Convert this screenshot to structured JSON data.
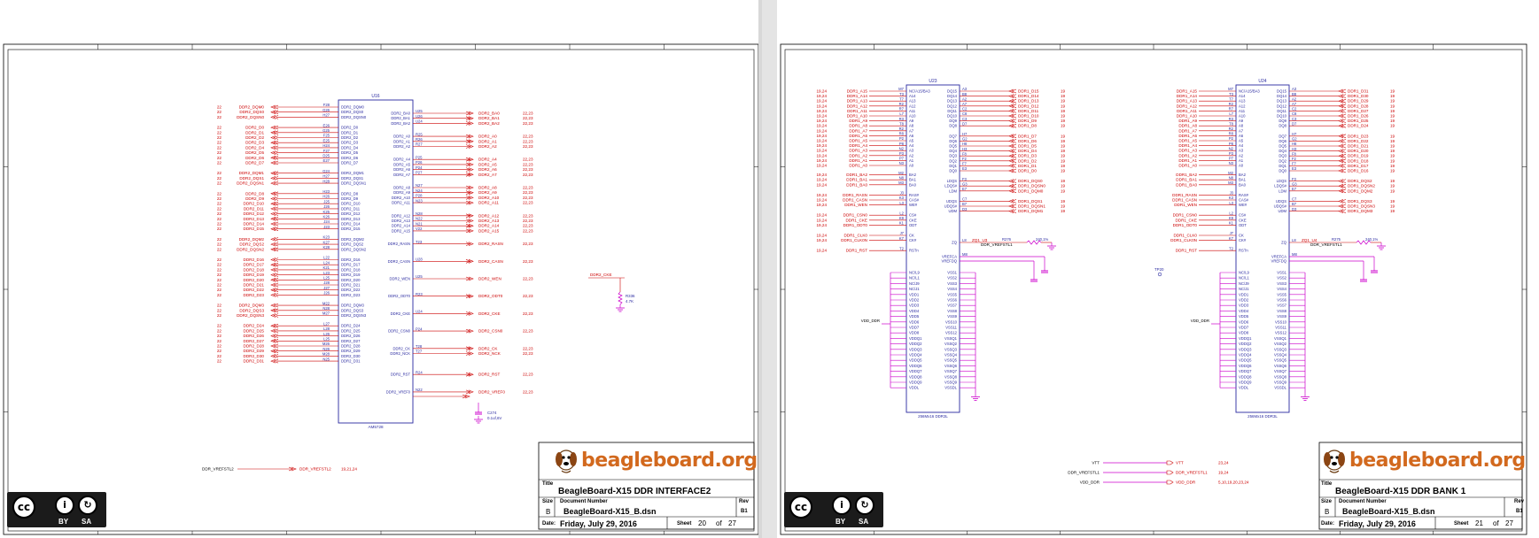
{
  "colors": {
    "wire": "#cc0000",
    "component": "#2a2aa0",
    "pin": "#cc00cc",
    "frame": "#000000",
    "brand": "#d2691e"
  },
  "left_sheet": {
    "title_block": {
      "logo_text": "beagleboard.org",
      "title_label": "Title",
      "title": "BeagleBoard-X15 DDR INTERFACE2",
      "size_label": "Size",
      "size": "B",
      "doc_label": "Document Number",
      "doc_number": "BeagleBoard-X15_B.dsn",
      "rev_label": "Rev",
      "rev": "B1",
      "date_label": "Date:",
      "date": "Friday, July 29, 2016",
      "sheet_label": "Sheet",
      "sheet": "20",
      "of_label": "of",
      "total": "27"
    },
    "license": {
      "by": "BY",
      "sa": "SA",
      "cc": "cc",
      "by_glyph": "i",
      "sa_glyph": "↻"
    },
    "refdes": "U16",
    "part": "AM5728",
    "vref_net": "DDR_VREFSTL2",
    "vref_dest": "DDR_VREFSTL2",
    "vref_page": "19,21,24",
    "left_pins": [
      {
        "pin": "F28",
        "name": "DDR2_DQM0"
      },
      {
        "pin": "G26",
        "name": "DDR2_DQS0"
      },
      {
        "pin": "H27",
        "name": "DDR2_DQSN0"
      },
      {
        "pin": "E26",
        "name": "DDR2_D0"
      },
      {
        "pin": "G25",
        "name": "DDR2_D1"
      },
      {
        "pin": "F25",
        "name": "DDR2_D2"
      },
      {
        "pin": "E25",
        "name": "DDR2_D3"
      },
      {
        "pin": "H24",
        "name": "DDR2_D4"
      },
      {
        "pin": "F27",
        "name": "DDR2_D5"
      },
      {
        "pin": "D25",
        "name": "DDR2_D6"
      },
      {
        "pin": "E27",
        "name": "DDR2_D7"
      },
      {
        "pin": "G24",
        "name": "DDR2_DQM1"
      },
      {
        "pin": "H27",
        "name": "DDR2_DQS1"
      },
      {
        "pin": "H28",
        "name": "DDR2_DQSN1"
      },
      {
        "pin": "H23",
        "name": "DDR2_D8"
      },
      {
        "pin": "H26",
        "name": "DDR2_D9"
      },
      {
        "pin": "J25",
        "name": "DDR2_D10"
      },
      {
        "pin": "J26",
        "name": "DDR2_D11"
      },
      {
        "pin": "K25",
        "name": "DDR2_D12"
      },
      {
        "pin": "K26",
        "name": "DDR2_D13"
      },
      {
        "pin": "J24",
        "name": "DDR2_D14"
      },
      {
        "pin": "J23",
        "name": "DDR2_D15"
      },
      {
        "pin": "K23",
        "name": "DDR2_DQM2"
      },
      {
        "pin": "K27",
        "name": "DDR2_DQS2"
      },
      {
        "pin": "K28",
        "name": "DDR2_DQSN2"
      },
      {
        "pin": "L22",
        "name": "DDR2_D16"
      },
      {
        "pin": "L24",
        "name": "DDR2_D17"
      },
      {
        "pin": "K21",
        "name": "DDR2_D18"
      },
      {
        "pin": "L23",
        "name": "DDR2_D19"
      },
      {
        "pin": "L25",
        "name": "DDR2_D20"
      },
      {
        "pin": "J28",
        "name": "DDR2_D21"
      },
      {
        "pin": "J27",
        "name": "DDR2_D22"
      },
      {
        "pin": "J26",
        "name": "DDR2_D23"
      },
      {
        "pin": "M22",
        "name": "DDR2_DQM3"
      },
      {
        "pin": "N28",
        "name": "DDR2_DQS3"
      },
      {
        "pin": "M27",
        "name": "DDR2_DQSN3"
      },
      {
        "pin": "L27",
        "name": "DDR2_D24"
      },
      {
        "pin": "L28",
        "name": "DDR2_D25"
      },
      {
        "pin": "L26",
        "name": "DDR2_D26"
      },
      {
        "pin": "L25",
        "name": "DDR2_D27"
      },
      {
        "pin": "M26",
        "name": "DDR2_D28"
      },
      {
        "pin": "N26",
        "name": "DDR2_D29"
      },
      {
        "pin": "M28",
        "name": "DDR2_D30"
      },
      {
        "pin": "N25",
        "name": "DDR2_D31"
      }
    ],
    "right_pins": [
      {
        "pin": "U25",
        "name": "DDR2_BA0"
      },
      {
        "pin": "U26",
        "name": "DDR2_BA1"
      },
      {
        "pin": "U24",
        "name": "DDR2_BA2"
      },
      {
        "pin": "R25",
        "name": "DDR2_A0"
      },
      {
        "pin": "R26",
        "name": "DDR2_A1"
      },
      {
        "pin": "R27",
        "name": "DDR2_A2"
      },
      {
        "pin": "P25",
        "name": "DDR2_A4"
      },
      {
        "pin": "P26",
        "name": "DDR2_A5"
      },
      {
        "pin": "P24",
        "name": "DDR2_A6"
      },
      {
        "pin": "P27",
        "name": "DDR2_A7"
      },
      {
        "pin": "N27",
        "name": "DDR2_A8"
      },
      {
        "pin": "N24",
        "name": "DDR2_A9"
      },
      {
        "pin": "P28",
        "name": "DDR2_A10"
      },
      {
        "pin": "N23",
        "name": "DDR2_A11"
      },
      {
        "pin": "N28",
        "name": "DDR2_A12"
      },
      {
        "pin": "N22",
        "name": "DDR2_A13"
      },
      {
        "pin": "N21",
        "name": "DDR2_A14"
      },
      {
        "pin": "V22",
        "name": "DDR2_A15"
      },
      {
        "pin": "T23",
        "name": "DDR2_RASN"
      },
      {
        "pin": "U28",
        "name": "DDR2_CASN"
      },
      {
        "pin": "U25",
        "name": "DDR2_WEN"
      },
      {
        "pin": "R23",
        "name": "DDR2_ODT0"
      },
      {
        "pin": "U24",
        "name": "DDR2_CKE"
      },
      {
        "pin": "P24",
        "name": "DDR2_CSN0"
      },
      {
        "pin": "T28",
        "name": "DDR2_CK"
      },
      {
        "pin": "T27",
        "name": "DDR2_NCK"
      },
      {
        "pin": "R24",
        "name": "DDR2_RST"
      },
      {
        "pin": "N22",
        "name": "DDR2_VREF0"
      }
    ],
    "cap": {
      "ref": "C274",
      "val": "0.1uf,6V"
    },
    "res": {
      "ref": "R336",
      "val": "4.7K",
      "net": "DDR2_CKE"
    }
  },
  "right_sheet": {
    "title_block": {
      "logo_text": "beagleboard.org",
      "title_label": "Title",
      "title": "BeagleBoard-X15 DDR BANK 1",
      "size_label": "Size",
      "size": "B",
      "doc_label": "Document Number",
      "doc_number": "BeagleBoard-X15_B.dsn",
      "rev_label": "Rev",
      "rev": "B1",
      "date_label": "Date:",
      "date": "Friday, July 29, 2016",
      "sheet_label": "Sheet",
      "sheet": "21",
      "of_label": "of",
      "total": "27"
    },
    "license": {
      "by": "BY",
      "sa": "SA",
      "cc": "cc",
      "by_glyph": "i",
      "sa_glyph": "↻"
    },
    "chip1": {
      "refdes": "U23",
      "part": "256Mx16 DDR3L",
      "zq_net": "ZQ1_U3",
      "zq_res": "R276",
      "zq_val": "240,1%",
      "vref": "DDR_VREFSTL1",
      "vdd": "VDD_DDR"
    },
    "chip2": {
      "refdes": "U24",
      "part": "256Mx16 DDR3L",
      "zq_net": "ZQ1_U4",
      "zq_res": "R275",
      "zq_val": "240,1%",
      "vref": "DDR_VREFSTL1",
      "vdd": "VDD_DDR"
    },
    "power_nets": [
      {
        "net": "VTT",
        "dest": "VTT",
        "page": "23,24"
      },
      {
        "net": "DDR_VREFSTL1",
        "dest": "DDR_VREFSTL1",
        "page": "19,24"
      },
      {
        "net": "VDD_DDR",
        "dest": "VDD_DDR",
        "page": "5,10,19,20,23,24"
      }
    ],
    "chip_left_pins": [
      {
        "pin": "M7",
        "name": "NC/A15/BA3"
      },
      {
        "pin": "T3",
        "name": "A14"
      },
      {
        "pin": "T7",
        "name": "A13"
      },
      {
        "pin": "R2",
        "name": "A12"
      },
      {
        "pin": "R7",
        "name": "A11"
      },
      {
        "pin": "L7",
        "name": "A10"
      },
      {
        "pin": "R3",
        "name": "A9"
      },
      {
        "pin": "T8",
        "name": "A8"
      },
      {
        "pin": "R2",
        "name": "A7"
      },
      {
        "pin": "R8",
        "name": "A6"
      },
      {
        "pin": "P2",
        "name": "A5"
      },
      {
        "pin": "P8",
        "name": "A4"
      },
      {
        "pin": "N2",
        "name": "A3"
      },
      {
        "pin": "P3",
        "name": "A2"
      },
      {
        "pin": "P7",
        "name": "A1"
      },
      {
        "pin": "N3",
        "name": "A0"
      },
      {
        "pin": "M2",
        "name": "BA2"
      },
      {
        "pin": "N8",
        "name": "BA1"
      },
      {
        "pin": "M3",
        "name": "BA0"
      },
      {
        "pin": "J3",
        "name": "RAS#"
      },
      {
        "pin": "K3",
        "name": "CAS#"
      },
      {
        "pin": "L3",
        "name": "WE#"
      },
      {
        "pin": "L2",
        "name": "CS#"
      },
      {
        "pin": "K9",
        "name": "CKE"
      },
      {
        "pin": "K1",
        "name": "ODT"
      },
      {
        "pin": "J7",
        "name": "CK"
      },
      {
        "pin": "K7",
        "name": "CK#"
      },
      {
        "pin": "T2",
        "name": "RSTn"
      }
    ],
    "chip_right_pins": [
      {
        "pin": "A3",
        "name": "DQ15"
      },
      {
        "pin": "B8",
        "name": "DQ14"
      },
      {
        "pin": "A2",
        "name": "DQ13"
      },
      {
        "pin": "A7",
        "name": "DQ12"
      },
      {
        "pin": "C2",
        "name": "DQ11"
      },
      {
        "pin": "C8",
        "name": "DQ10"
      },
      {
        "pin": "C3",
        "name": "DQ9"
      },
      {
        "pin": "D7",
        "name": "DQ8"
      },
      {
        "pin": "H7",
        "name": "DQ7"
      },
      {
        "pin": "G2",
        "name": "DQ6"
      },
      {
        "pin": "H8",
        "name": "DQ5"
      },
      {
        "pin": "H3",
        "name": "DQ4"
      },
      {
        "pin": "F8",
        "name": "DQ3"
      },
      {
        "pin": "F2",
        "name": "DQ2"
      },
      {
        "pin": "F7",
        "name": "DQ1"
      },
      {
        "pin": "E3",
        "name": "DQ0"
      },
      {
        "pin": "F3",
        "name": "LDQS"
      },
      {
        "pin": "G3",
        "name": "LDQS#"
      },
      {
        "pin": "E7",
        "name": "LDM"
      },
      {
        "pin": "C7",
        "name": "UDQS"
      },
      {
        "pin": "B7",
        "name": "UDQS#"
      },
      {
        "pin": "D3",
        "name": "UDM"
      },
      {
        "pin": "L8",
        "name": "ZQ"
      },
      {
        "pin": "M8",
        "name": "VREFCA"
      },
      {
        "pin": "H1",
        "name": "VREFDQ"
      }
    ],
    "chip_power_pins": [
      "NC/L9",
      "NC/L1",
      "NC/J9",
      "NC/J1",
      "VDD1",
      "VDD2",
      "VDD3",
      "VDD4",
      "VDD5",
      "VDD6",
      "VDD7",
      "VDD8",
      "VDDQ1",
      "VDDQ2",
      "VDDQ3",
      "VDDQ4",
      "VDDQ5",
      "VDDQ6",
      "VDDQ7",
      "VDDQ8",
      "VDDQ9",
      "VDDL"
    ],
    "chip_gnd_pins": [
      "VSS1",
      "VSS2",
      "VSS3",
      "VSS4",
      "VSS5",
      "VSS6",
      "VSS7",
      "VSS8",
      "VSS9",
      "VSS10",
      "VSS11",
      "VSS12",
      "VSSQ1",
      "VSSQ2",
      "VSSQ3",
      "VSSQ4",
      "VSSQ5",
      "VSSQ6",
      "VSSQ7",
      "VSSQ8",
      "VSSQ9",
      "VSSDL"
    ],
    "chip1_left_nets": [
      "DDR1_A15",
      "DDR1_A14",
      "DDR1_A13",
      "DDR1_A12",
      "DDR1_A11",
      "DDR1_A10",
      "DDR1_A9",
      "DDR1_A8",
      "DDR1_A7",
      "DDR1_A6",
      "DDR1_A5",
      "DDR1_A4",
      "DDR1_A3",
      "DDR1_A2",
      "DDR1_A1",
      "DDR1_A0",
      "DDR1_BA2",
      "DDR1_BA1",
      "DDR1_BA0",
      "DDR1_RASN",
      "DDR1_CASN",
      "DDR1_WEN",
      "DDR1_CSN0",
      "DDR1_CKE",
      "DDR1_ODT0",
      "DDR1_CLK0",
      "DDR1_CLK0N",
      "DDR1_RST"
    ],
    "chip1_right_nets": [
      "DDR1_D15",
      "DDR1_D14",
      "DDR1_D13",
      "DDR1_D12",
      "DDR1_D11",
      "DDR1_D10",
      "DDR1_D9",
      "DDR1_D8",
      "DDR1_D7",
      "DDR1_D6",
      "DDR1_D5",
      "DDR1_D4",
      "DDR1_D3",
      "DDR1_D2",
      "DDR1_D1",
      "DDR1_D0",
      "DDR1_DQS0",
      "DDR1_DQSN0",
      "DDR1_DQM0",
      "DDR1_DQS1",
      "DDR1_DQSN1",
      "DDR1_DQM1"
    ],
    "chip2_right_nets": [
      "DDR1_D31",
      "DDR1_D30",
      "DDR1_D29",
      "DDR1_D28",
      "DDR1_D27",
      "DDR1_D26",
      "DDR1_D25",
      "DDR1_D24",
      "DDR1_D23",
      "DDR1_D22",
      "DDR1_D21",
      "DDR1_D20",
      "DDR1_D19",
      "DDR1_D18",
      "DDR1_D17",
      "DDR1_D16",
      "DDR1_DQS2",
      "DDR1_DQSN2",
      "DDR1_DQM2",
      "DDR1_DQS3",
      "DDR1_DQSN3",
      "DDR1_DQM3"
    ],
    "page_ref_left": "19,24",
    "page_ref_right": "19",
    "tp_label": "TP20"
  }
}
